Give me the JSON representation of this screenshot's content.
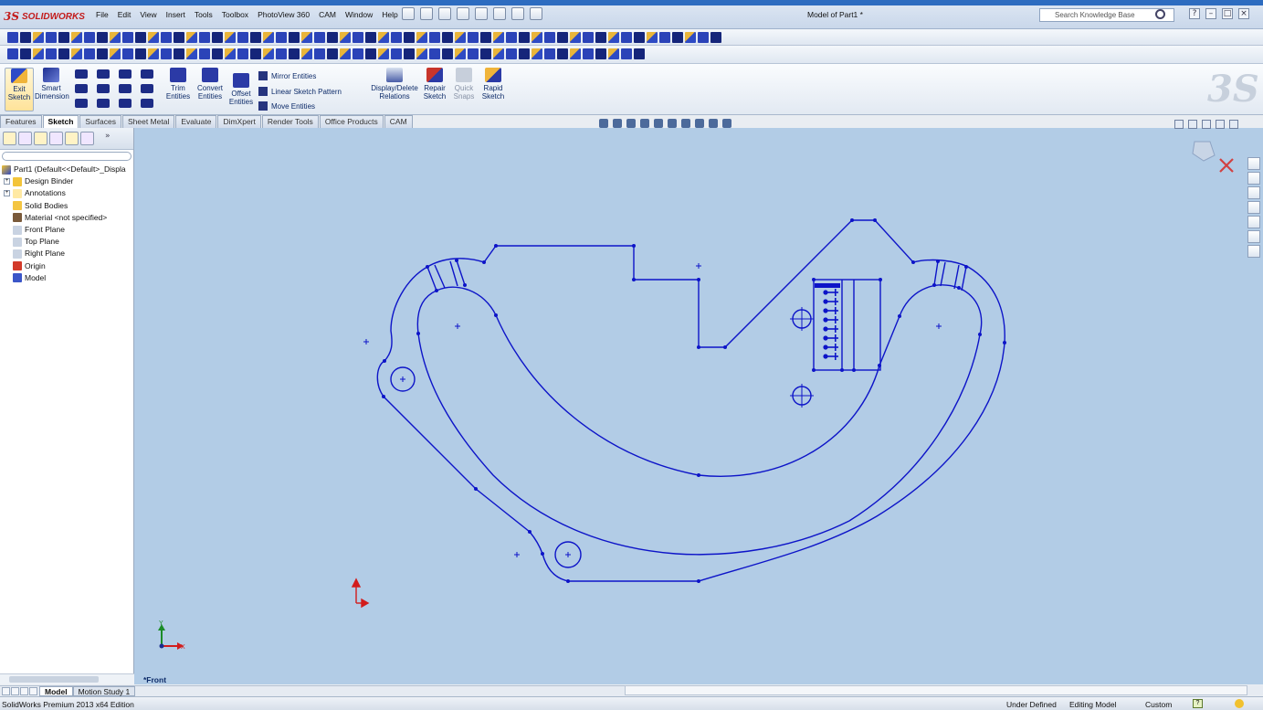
{
  "app": {
    "logo_mark": "3S",
    "logo_text": "SOLIDWORKS",
    "document_title": "Model of Part1 *"
  },
  "menu": [
    "File",
    "Edit",
    "View",
    "Insert",
    "Tools",
    "Toolbox",
    "PhotoView 360",
    "CAM",
    "Window",
    "Help"
  ],
  "search": {
    "placeholder": "Search Knowledge Base"
  },
  "command_manager": {
    "exit_sketch": "Exit Sketch",
    "smart_dimension": "Smart Dimension",
    "trim_entities": "Trim Entities",
    "convert_entities": "Convert Entities",
    "offset_entities": "Offset Entities",
    "mirror_entities": "Mirror Entities",
    "linear_sketch_pattern": "Linear Sketch Pattern",
    "move_entities": "Move Entities",
    "display_delete_relations": "Display/Delete Relations",
    "repair_sketch": "Repair Sketch",
    "quick_snaps": "Quick Snaps",
    "rapid_sketch": "Rapid Sketch"
  },
  "tabs": [
    {
      "label": "Features",
      "active": false
    },
    {
      "label": "Sketch",
      "active": true
    },
    {
      "label": "Surfaces",
      "active": false
    },
    {
      "label": "Sheet Metal",
      "active": false
    },
    {
      "label": "Evaluate",
      "active": false
    },
    {
      "label": "DimXpert",
      "active": false
    },
    {
      "label": "Render Tools",
      "active": false
    },
    {
      "label": "Office Products",
      "active": false
    },
    {
      "label": "CAM",
      "active": false
    }
  ],
  "feature_tree": {
    "root": "Part1  (Default<<Default>_Displa",
    "items": [
      {
        "label": "Design Binder",
        "expandable": true,
        "icon": "binder-icon"
      },
      {
        "label": "Annotations",
        "expandable": true,
        "icon": "annotations-icon"
      },
      {
        "label": "Solid Bodies",
        "expandable": false,
        "icon": "solid-bodies-icon"
      },
      {
        "label": "Material <not specified>",
        "expandable": false,
        "icon": "material-icon"
      },
      {
        "label": "Front Plane",
        "expandable": false,
        "icon": "plane-icon"
      },
      {
        "label": "Top Plane",
        "expandable": false,
        "icon": "plane-icon"
      },
      {
        "label": "Right Plane",
        "expandable": false,
        "icon": "plane-icon"
      },
      {
        "label": "Origin",
        "expandable": false,
        "icon": "origin-icon"
      },
      {
        "label": "Model",
        "expandable": false,
        "icon": "sketch-icon"
      }
    ]
  },
  "viewport": {
    "view_name": "*Front",
    "triad_x": "X",
    "triad_y": "Y",
    "sketch_color": "#0d14c8",
    "background_color": "#b2cce6"
  },
  "bottom_tabs": [
    {
      "label": "Model",
      "active": true
    },
    {
      "label": "Motion Study 1",
      "active": false
    }
  ],
  "status": {
    "edition": "SolidWorks Premium 2013 x64 Edition",
    "sketch_state": "Under Defined",
    "edit_mode": "Editing Model",
    "units": "Custom",
    "help": "?"
  }
}
